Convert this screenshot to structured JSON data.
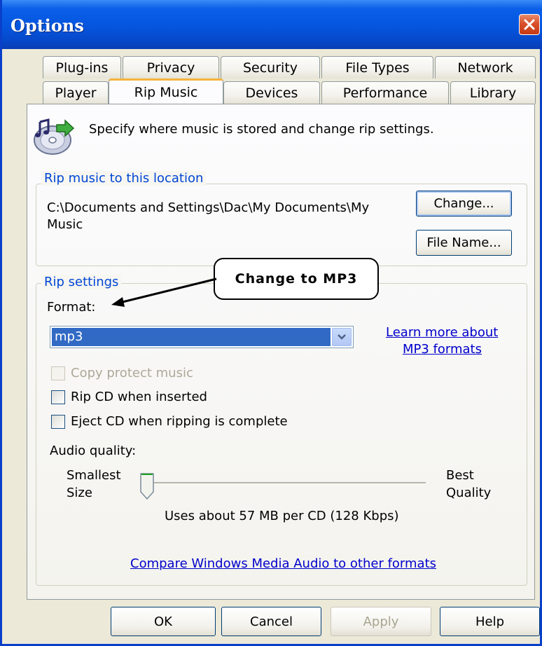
{
  "window": {
    "title": "Options"
  },
  "tabs": {
    "row1": [
      "Plug-ins",
      "Privacy",
      "Security",
      "File Types",
      "Network"
    ],
    "row2": [
      "Player",
      "Rip Music",
      "Devices",
      "Performance",
      "Library"
    ],
    "active": "Rip Music"
  },
  "header": {
    "description": "Specify where music is stored and change rip settings."
  },
  "location": {
    "legend": "Rip music to this location",
    "path_line1": "C:\\Documents and Settings\\Dac\\My Documents\\My",
    "path_line2": "Music",
    "change_label": "Change...",
    "filename_label": "File Name..."
  },
  "rip_settings": {
    "legend": "Rip settings",
    "format_label": "Format:",
    "format_value": "mp3",
    "learn_more_line1": "Learn more about",
    "learn_more_line2": "MP3 formats",
    "copy_protect_label": "Copy protect music",
    "copy_protect_checked": false,
    "rip_cd_label": "Rip CD when inserted",
    "rip_cd_checked": false,
    "eject_label": "Eject CD when ripping is complete",
    "eject_checked": false,
    "audio_quality_label": "Audio quality:",
    "smallest_line1": "Smallest",
    "smallest_line2": "Size",
    "best_line1": "Best",
    "best_line2": "Quality",
    "slider_level": 0,
    "usage_text": "Uses about 57 MB per CD (128 Kbps)",
    "compare_link": "Compare Windows Media Audio to other formats"
  },
  "annotation": {
    "callout_text": "Change to MP3"
  },
  "footer": {
    "ok_label": "OK",
    "cancel_label": "Cancel",
    "apply_label": "Apply",
    "help_label": "Help"
  },
  "colors": {
    "titlebar": "#0555de",
    "dialog_bg": "#ece9d8",
    "legend_text": "#0046d5",
    "selection": "#316ac5",
    "link": "#0000cc",
    "active_tab_accent": "#f5b33c"
  }
}
